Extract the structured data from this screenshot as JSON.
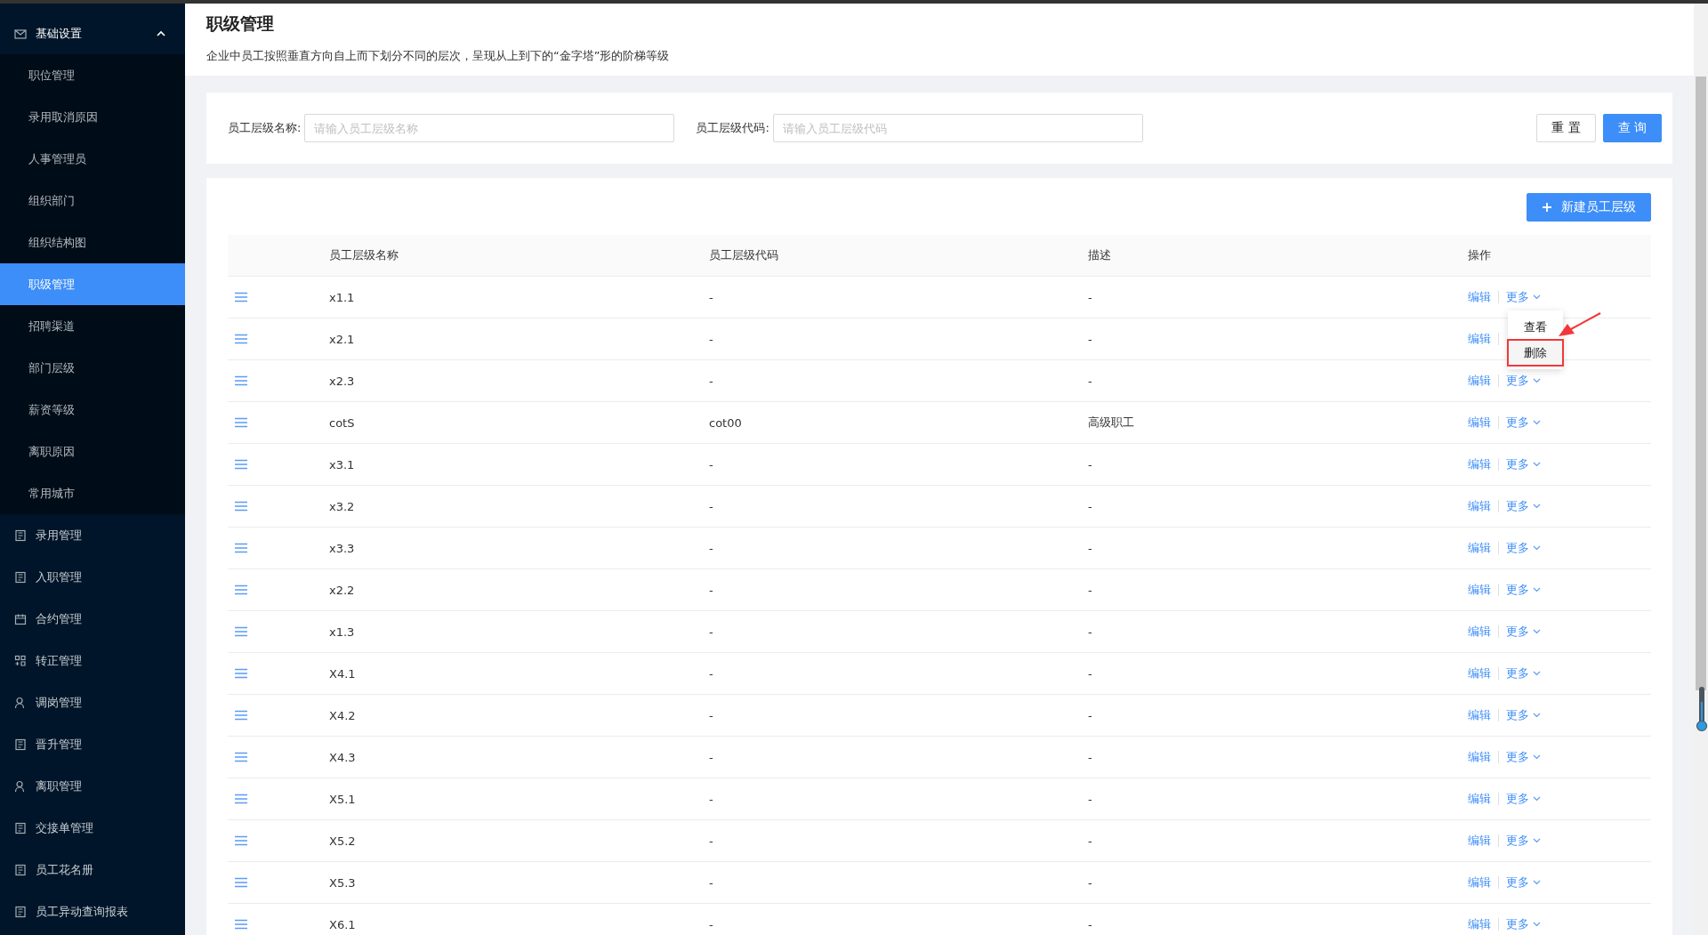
{
  "sidebar": {
    "groups": [
      {
        "label": "基础设置",
        "expanded": true,
        "children": [
          {
            "label": "职位管理",
            "selected": false
          },
          {
            "label": "录用取消原因",
            "selected": false
          },
          {
            "label": "人事管理员",
            "selected": false
          },
          {
            "label": "组织部门",
            "selected": false
          },
          {
            "label": "组织结构图",
            "selected": false
          },
          {
            "label": "职级管理",
            "selected": true
          },
          {
            "label": "招聘渠道",
            "selected": false
          },
          {
            "label": "部门层级",
            "selected": false
          },
          {
            "label": "薪资等级",
            "selected": false
          },
          {
            "label": "离职原因",
            "selected": false
          },
          {
            "label": "常用城市",
            "selected": false
          }
        ]
      },
      {
        "label": "录用管理",
        "expanded": false
      },
      {
        "label": "入职管理",
        "expanded": false
      },
      {
        "label": "合约管理",
        "expanded": false
      },
      {
        "label": "转正管理",
        "expanded": false
      },
      {
        "label": "调岗管理",
        "expanded": false
      },
      {
        "label": "晋升管理",
        "expanded": false
      },
      {
        "label": "离职管理",
        "expanded": false
      },
      {
        "label": "交接单管理",
        "expanded": false
      },
      {
        "label": "员工花名册",
        "expanded": false
      },
      {
        "label": "员工异动查询报表",
        "expanded": false
      }
    ]
  },
  "page": {
    "title": "职级管理",
    "description": "企业中员工按照垂直方向自上而下划分不同的层次，呈现从上到下的“金字塔”形的阶梯等级"
  },
  "filters": [
    {
      "label": "员工层级名称:",
      "placeholder": "请输入员工层级名称"
    },
    {
      "label": "员工层级代码:",
      "placeholder": "请输入员工层级代码"
    }
  ],
  "filter_buttons": {
    "reset": "重 置",
    "search": "查 询"
  },
  "new_button": "新建员工层级",
  "table": {
    "columns": [
      "员工层级名称",
      "员工层级代码",
      "描述",
      "操作"
    ],
    "rows": [
      {
        "name": "x1.1",
        "code": "-",
        "description": "-",
        "edit": "编辑",
        "more": "更多",
        "menu": [
          {
            "label": "查看",
            "selected": false
          },
          {
            "label": "删除",
            "selected": true
          }
        ]
      },
      {
        "name": "x2.1",
        "code": "-",
        "description": "-",
        "edit": "编辑"
      },
      {
        "name": "x2.3",
        "code": "-",
        "description": "-",
        "edit": "编辑",
        "more": "更多"
      },
      {
        "name": "cotS",
        "code": "cot00",
        "description": "高级职工",
        "edit": "编辑",
        "more": "更多"
      },
      {
        "name": "x3.1",
        "code": "-",
        "description": "-",
        "edit": "编辑",
        "more": "更多"
      },
      {
        "name": "x3.2",
        "code": "-",
        "description": "-",
        "edit": "编辑",
        "more": "更多"
      },
      {
        "name": "x3.3",
        "code": "-",
        "description": "-",
        "edit": "编辑",
        "more": "更多"
      },
      {
        "name": "x2.2",
        "code": "-",
        "description": "-",
        "edit": "编辑",
        "more": "更多"
      },
      {
        "name": "x1.3",
        "code": "-",
        "description": "-",
        "edit": "编辑",
        "more": "更多"
      },
      {
        "name": "X4.1",
        "code": "-",
        "description": "-",
        "edit": "编辑",
        "more": "更多"
      },
      {
        "name": "X4.2",
        "code": "-",
        "description": "-",
        "edit": "编辑",
        "more": "更多"
      },
      {
        "name": "X4.3",
        "code": "-",
        "description": "-",
        "edit": "编辑",
        "more": "更多"
      },
      {
        "name": "X5.1",
        "code": "-",
        "description": "-",
        "edit": "编辑",
        "more": "更多"
      },
      {
        "name": "X5.2",
        "code": "-",
        "description": "-",
        "edit": "编辑",
        "more": "更多"
      },
      {
        "name": "X5.3",
        "code": "-",
        "description": "-",
        "edit": "编辑",
        "more": "更多"
      },
      {
        "name": "X6.1",
        "code": "-",
        "description": "-",
        "edit": "编辑",
        "more": "更多"
      }
    ]
  }
}
